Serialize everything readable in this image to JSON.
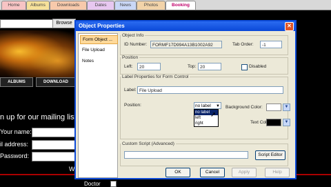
{
  "tabs": [
    {
      "label": "Home",
      "color": "#f7c4c4"
    },
    {
      "label": "Albums",
      "color": "#f6e19a"
    },
    {
      "label": "Downloads",
      "color": "#f7c9ab"
    },
    {
      "label": "Dates",
      "color": "#e7c7f0"
    },
    {
      "label": "News",
      "color": "#c9d7f6"
    },
    {
      "label": "Photos",
      "color": "#f2d3a9"
    },
    {
      "label": "Booking",
      "color": "#ffffff"
    }
  ],
  "background": {
    "browse_label": "Browse",
    "nav": [
      "ALBUMS",
      "DOWNLOAD"
    ],
    "mailing_text": "n up for our mailing list",
    "fields": [
      "Your name:",
      "il address:",
      "Password:"
    ],
    "w_text": "W",
    "doctor_text": "Doctor"
  },
  "dialog": {
    "title": "Object Properties",
    "close": "✕",
    "nav": [
      "Form Object ...",
      "File Upload",
      "Notes"
    ],
    "object_info": {
      "legend": "Object Info",
      "id_label": "ID Number:",
      "id_value": "FORMF17D994A13B1002A92",
      "tab_label": "Tab Order:",
      "tab_value": "-1"
    },
    "position": {
      "legend": "Position",
      "left_label": "Left:",
      "left_value": "20",
      "top_label": "Top:",
      "top_value": "20",
      "disabled_label": "Disabled"
    },
    "label_props": {
      "legend": "Label Properties for Form Control",
      "label_label": "Label:",
      "label_value": "File Upload",
      "position_label": "Position:",
      "position_value": "no label",
      "options": [
        "no label",
        "left",
        "right"
      ],
      "bg_color_label": "Background Color:",
      "bg_color": "#ffffff",
      "text_color_label": "Text Color:",
      "text_color": "#000000"
    },
    "script": {
      "legend": "Custom Script (Advanced)",
      "button": "Script Editor"
    },
    "buttons": {
      "ok": "OK",
      "cancel": "Cancel",
      "apply": "Apply",
      "help": "Help"
    }
  }
}
